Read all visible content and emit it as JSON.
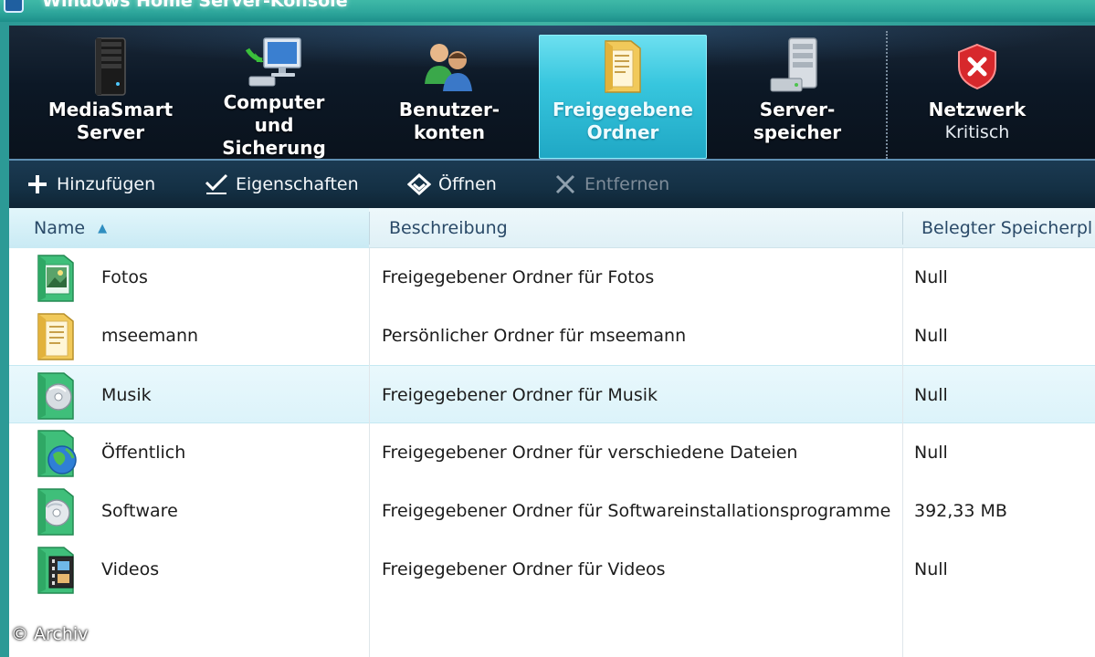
{
  "window": {
    "title": "Windows Home Server-Konsole"
  },
  "nav": {
    "tabs": [
      {
        "line1": "MediaSmart",
        "line2": "Server",
        "icon": "server-tower-icon",
        "active": false
      },
      {
        "line1": "Computer",
        "line2": "und Sicherung",
        "icon": "computer-backup-icon",
        "active": false
      },
      {
        "line1": "Benutzer-",
        "line2": "konten",
        "icon": "user-accounts-icon",
        "active": false
      },
      {
        "line1": "Freigegebene",
        "line2": "Ordner",
        "icon": "shared-folder-icon",
        "active": true
      },
      {
        "line1": "Server-",
        "line2": "speicher",
        "icon": "server-storage-icon",
        "active": false
      },
      {
        "line1": "Netzwerk",
        "line2": "Kritisch",
        "icon": "network-critical-shield-icon",
        "active": false
      }
    ]
  },
  "toolbar": {
    "add": "Hinzufügen",
    "properties": "Eigenschaften",
    "open": "Öffnen",
    "remove": "Entfernen"
  },
  "columns": {
    "name": "Name",
    "description": "Beschreibung",
    "used": "Belegter Speicherpl"
  },
  "rows": [
    {
      "name": "Fotos",
      "description": "Freigegebener Ordner für Fotos",
      "used": "Null",
      "icon": "photos-folder-icon",
      "selected": false
    },
    {
      "name": "mseemann",
      "description": "Persönlicher Ordner für mseemann",
      "used": "Null",
      "icon": "personal-folder-icon",
      "selected": false
    },
    {
      "name": "Musik",
      "description": "Freigegebener Ordner für Musik",
      "used": "Null",
      "icon": "music-folder-icon",
      "selected": true
    },
    {
      "name": "Öffentlich",
      "description": "Freigegebener Ordner für verschiedene Dateien",
      "used": "Null",
      "icon": "public-folder-icon",
      "selected": false
    },
    {
      "name": "Software",
      "description": "Freigegebener Ordner für Softwareinstallationsprogramme",
      "used": "392,33 MB",
      "icon": "software-folder-icon",
      "selected": false
    },
    {
      "name": "Videos",
      "description": "Freigegebener Ordner für Videos",
      "used": "Null",
      "icon": "videos-folder-icon",
      "selected": false
    }
  ],
  "watermark": "© Archiv",
  "colors": {
    "active_tab": "#37c6de",
    "nav_background": "#0c1826",
    "toolbar_background": "#143044",
    "selected_row": "#dcf3fa",
    "shared_folder_green": "#3fbf7a"
  }
}
